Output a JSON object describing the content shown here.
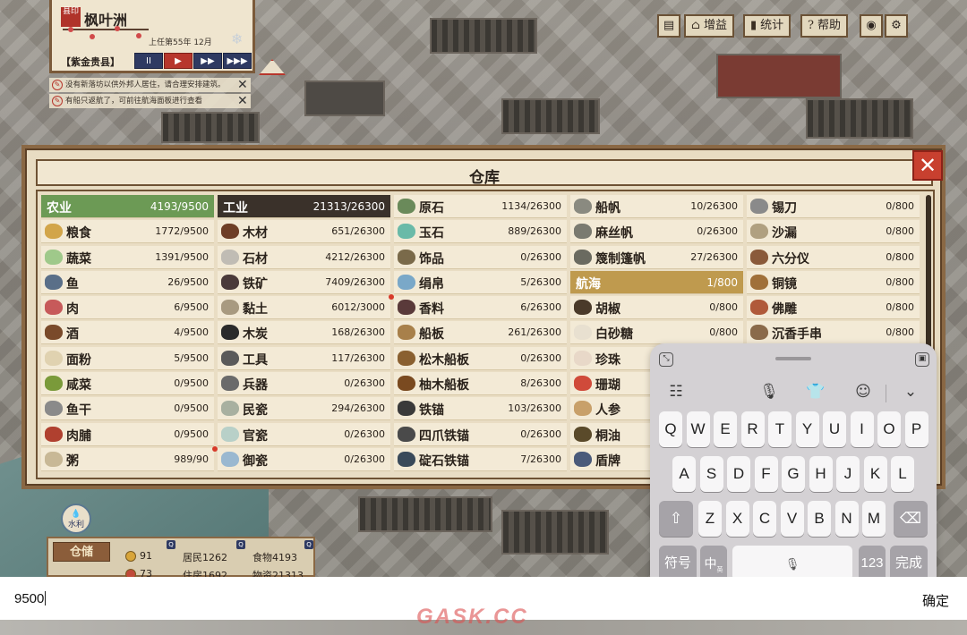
{
  "city": {
    "name": "枫叶洲",
    "seal_text": "县印",
    "date": "上任第55年 12月",
    "county": "【紫金贵县】",
    "speed_buttons": [
      "II",
      "▶",
      "▶▶",
      "▶▶▶"
    ]
  },
  "notices": [
    "没有新落坊以供外邦人居住，请合理安排建筑。",
    "有船只返航了，可前往航海面板进行查看"
  ],
  "toolbar": {
    "buff_label": "增益",
    "stats_label": "统计",
    "help_label": "帮助"
  },
  "warehouse": {
    "title": "仓库",
    "columns": [
      [
        {
          "name": "农业",
          "count": "4193/9500",
          "header": "agri"
        },
        {
          "name": "粮食",
          "count": "1772/9500",
          "icon": "#d2a54a"
        },
        {
          "name": "蔬菜",
          "count": "1391/9500",
          "icon": "#9fc98a"
        },
        {
          "name": "鱼",
          "count": "26/9500",
          "icon": "#5a6f88"
        },
        {
          "name": "肉",
          "count": "6/9500",
          "icon": "#c75a5a"
        },
        {
          "name": "酒",
          "count": "4/9500",
          "icon": "#7a4a2a"
        },
        {
          "name": "面粉",
          "count": "5/9500",
          "icon": "#e0d2b0"
        },
        {
          "name": "咸菜",
          "count": "0/9500",
          "icon": "#7a9a3a"
        },
        {
          "name": "鱼干",
          "count": "0/9500",
          "icon": "#8a8a8a"
        },
        {
          "name": "肉脯",
          "count": "0/9500",
          "icon": "#b0402f"
        },
        {
          "name": "粥",
          "count": "989/90",
          "icon": "#c8b896",
          "dot": true
        }
      ],
      [
        {
          "name": "工业",
          "count": "21313/26300",
          "header": "ind"
        },
        {
          "name": "木材",
          "count": "651/26300",
          "icon": "#6e3e26"
        },
        {
          "name": "石材",
          "count": "4212/26300",
          "icon": "#c0bcb4"
        },
        {
          "name": "铁矿",
          "count": "7409/26300",
          "icon": "#4a3a3a"
        },
        {
          "name": "黏土",
          "count": "6012/3000",
          "icon": "#a89a80",
          "dot": true
        },
        {
          "name": "木炭",
          "count": "168/26300",
          "icon": "#2a2a2a"
        },
        {
          "name": "工具",
          "count": "117/26300",
          "icon": "#5a5a5a"
        },
        {
          "name": "兵器",
          "count": "0/26300",
          "icon": "#6a6a6a"
        },
        {
          "name": "民瓷",
          "count": "294/26300",
          "icon": "#a8b0a0"
        },
        {
          "name": "官瓷",
          "count": "0/26300",
          "icon": "#b8d0c8"
        },
        {
          "name": "御瓷",
          "count": "0/26300",
          "icon": "#9ab8d0"
        }
      ],
      [
        {
          "name": "原石",
          "count": "1134/26300",
          "icon": "#6a8a5a"
        },
        {
          "name": "玉石",
          "count": "889/26300",
          "icon": "#6abaa8"
        },
        {
          "name": "饰品",
          "count": "0/26300",
          "icon": "#7a6a4a"
        },
        {
          "name": "绢帛",
          "count": "5/26300",
          "icon": "#7aa8c8"
        },
        {
          "name": "香料",
          "count": "6/26300",
          "icon": "#5a3a3a"
        },
        {
          "name": "船板",
          "count": "261/26300",
          "icon": "#a8804a"
        },
        {
          "name": "松木船板",
          "count": "0/26300",
          "icon": "#8a6030"
        },
        {
          "name": "柚木船板",
          "count": "8/26300",
          "icon": "#7a4a20"
        },
        {
          "name": "铁锚",
          "count": "103/26300",
          "icon": "#3a3a3a"
        },
        {
          "name": "四爪铁锚",
          "count": "0/26300",
          "icon": "#4a4a4a"
        },
        {
          "name": "碇石铁锚",
          "count": "7/26300",
          "icon": "#3a4a5a"
        }
      ],
      [
        {
          "name": "船帆",
          "count": "10/26300",
          "icon": "#8a8a80"
        },
        {
          "name": "麻丝帆",
          "count": "0/26300",
          "icon": "#7a7a70"
        },
        {
          "name": "篾制篷帆",
          "count": "27/26300",
          "icon": "#6a6a60"
        },
        {
          "name": "航海",
          "count": "1/800",
          "header": "sea"
        },
        {
          "name": "胡椒",
          "count": "0/800",
          "icon": "#4a3a2a"
        },
        {
          "name": "白砂糖",
          "count": "0/800",
          "icon": "#e8e0d0"
        },
        {
          "name": "珍珠",
          "count": "",
          "icon": "#e8d8c8"
        },
        {
          "name": "珊瑚",
          "count": "",
          "icon": "#d04a3a"
        },
        {
          "name": "人参",
          "count": "",
          "icon": "#c8a06a"
        },
        {
          "name": "桐油",
          "count": "",
          "icon": "#5a4a2a"
        },
        {
          "name": "盾牌",
          "count": "",
          "icon": "#4a5a7a"
        }
      ],
      [
        {
          "name": "锡刀",
          "count": "0/800",
          "icon": "#8a8a8a"
        },
        {
          "name": "沙漏",
          "count": "0/800",
          "icon": "#b0a080"
        },
        {
          "name": "六分仪",
          "count": "0/800",
          "icon": "#8a5a3a"
        },
        {
          "name": "铜镜",
          "count": "0/800",
          "icon": "#a0703a"
        },
        {
          "name": "佛雕",
          "count": "0/800",
          "icon": "#b05a3a"
        },
        {
          "name": "沉香手串",
          "count": "0/800",
          "icon": "#8a6a4a"
        }
      ]
    ]
  },
  "resources": {
    "warehouse_label": "仓储",
    "coins": "91",
    "residents": "居民1262",
    "food": "食物4193",
    "row2_a": "73",
    "row2_b": "住房1692",
    "row2_c": "物资21313",
    "water_label": "水利"
  },
  "keyboard": {
    "row1": [
      "Q",
      "W",
      "E",
      "R",
      "T",
      "Y",
      "U",
      "I",
      "O",
      "P"
    ],
    "row2": [
      "A",
      "S",
      "D",
      "F",
      "G",
      "H",
      "J",
      "K",
      "L"
    ],
    "row3": [
      "Z",
      "X",
      "C",
      "V",
      "B",
      "N",
      "M"
    ],
    "symbols_label": "符号",
    "lang_label": "中",
    "lang_sub": "英",
    "num_label": "123",
    "done_label": "完成"
  },
  "input": {
    "value": "9500",
    "confirm_label": "确定"
  },
  "watermark": "GASK.CC"
}
